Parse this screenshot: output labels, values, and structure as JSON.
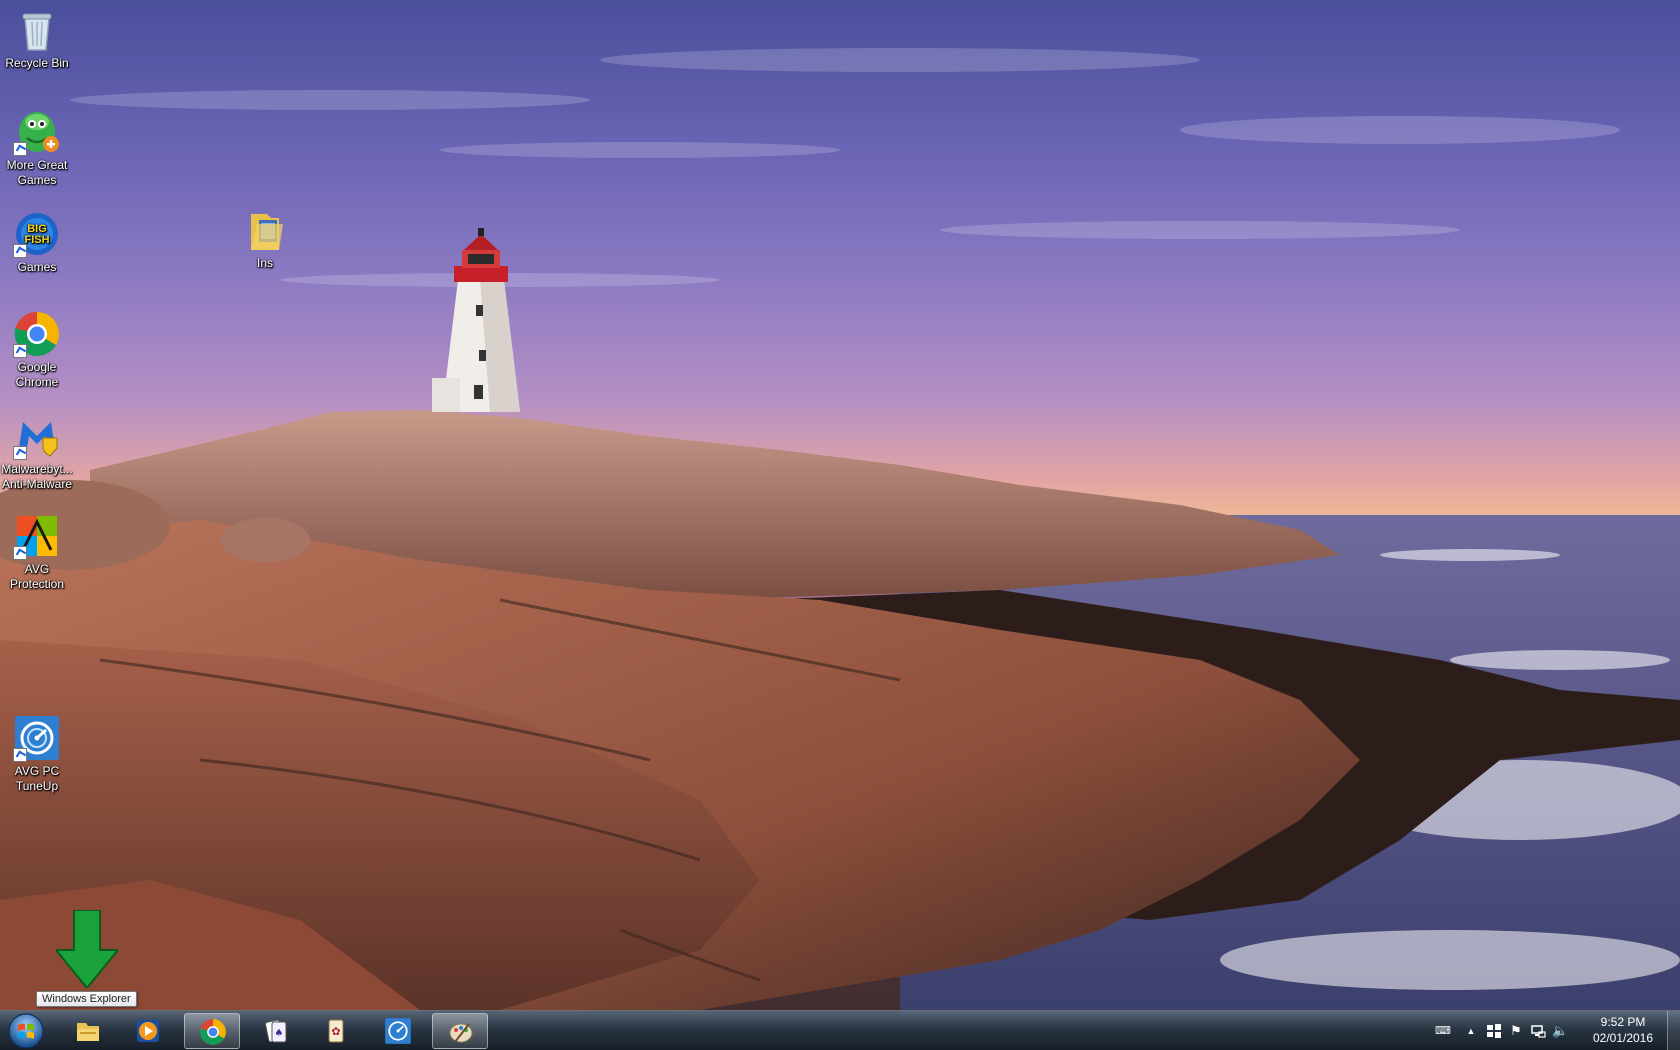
{
  "desktop": {
    "icons": [
      {
        "label": "Recycle Bin",
        "icon": "recycle-bin-icon"
      },
      {
        "label": "More Great Games",
        "icon": "more-great-games-icon"
      },
      {
        "label": "Games",
        "icon": "big-fish-games-icon"
      },
      {
        "label": "Google Chrome",
        "icon": "chrome-icon"
      },
      {
        "label": "Malwarebyt... Anti-Malware",
        "icon": "malwarebytes-icon"
      },
      {
        "label": "AVG Protection",
        "icon": "avg-icon"
      },
      {
        "label": "AVG PC TuneUp",
        "icon": "avg-tuneup-icon"
      },
      {
        "label": "Ins",
        "icon": "folder-icon"
      }
    ]
  },
  "tooltip": {
    "text": "Windows Explorer"
  },
  "taskbar": {
    "start": "windows-start-icon",
    "pinned": [
      {
        "name": "windows-explorer",
        "icon": "folder-icon"
      },
      {
        "name": "media-player",
        "icon": "media-player-icon"
      },
      {
        "name": "chrome",
        "icon": "chrome-icon"
      },
      {
        "name": "solitaire",
        "icon": "cards-icon"
      },
      {
        "name": "mahjong",
        "icon": "mahjong-icon"
      },
      {
        "name": "avg-tuneup",
        "icon": "avg-tuneup-icon"
      },
      {
        "name": "paint",
        "icon": "paint-icon"
      }
    ],
    "clock": {
      "time": "9:52 PM",
      "date": "02/01/2016"
    }
  },
  "colors": {
    "arrow": "#1aa33a",
    "taskbar": "#1e2a36"
  }
}
